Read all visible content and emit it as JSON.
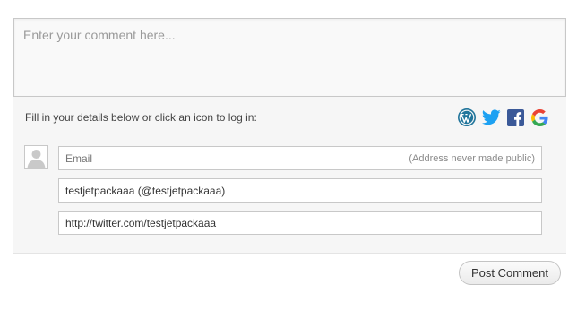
{
  "comment": {
    "placeholder": "Enter your comment here..."
  },
  "login": {
    "prompt": "Fill in your details below or click an icon to log in:",
    "icons": [
      "wordpress-icon",
      "twitter-icon",
      "facebook-icon",
      "google-icon"
    ]
  },
  "colors": {
    "wordpress": "#21759b",
    "twitter": "#1da1f2",
    "facebook": "#3b5998",
    "google_blue": "#4285f4",
    "google_red": "#ea4335",
    "google_yellow": "#fbbc05",
    "google_green": "#34a853"
  },
  "fields": {
    "email": {
      "placeholder": "Email",
      "hint": "(Address never made public)"
    },
    "name": {
      "value": "testjetpackaaa (@testjetpackaaa)"
    },
    "website": {
      "value": "http://twitter.com/testjetpackaaa"
    }
  },
  "submit": {
    "label": "Post Comment"
  }
}
